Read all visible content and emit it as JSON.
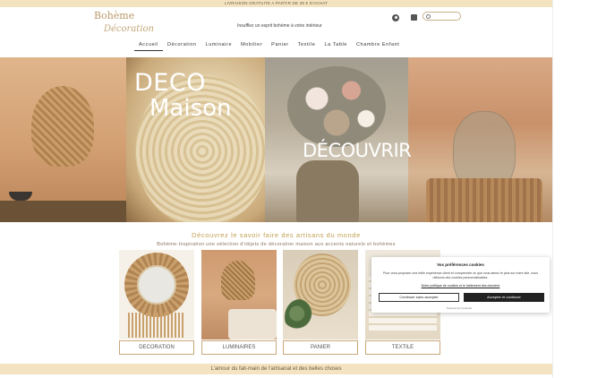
{
  "topbar": {
    "text": "LIVRAISON GRATUITE A PARTIR DE 39 € D'ACHAT"
  },
  "header": {
    "logo_line1": "Bohème",
    "logo_line2": "Décoration",
    "tagline": "Insufflez un esprit bohème à votre intérieur"
  },
  "nav": {
    "items": [
      "Accueil",
      "Décoration",
      "Luminaire",
      "Mobilier",
      "Panier",
      "Textile",
      "La Table",
      "Chambre Enfant"
    ],
    "active": "Accueil"
  },
  "hero": {
    "title_line1": "DECO",
    "title_line2": "Maison",
    "cta": "DÉCOUVRIR"
  },
  "section": {
    "title": "Découvrez le savoir faire des artisans du monde",
    "subtitle": "Bohème-Inspiration une sélection d'objets de décoration maison aux accents naturels et bohèmes"
  },
  "categories": [
    {
      "label": "DECORATION"
    },
    {
      "label": "LUMINAIRES"
    },
    {
      "label": "PANIER"
    },
    {
      "label": "TEXTILE"
    }
  ],
  "footer": {
    "text": "L'amour du fait-main de l'artisanat et des belles choses"
  },
  "cookie": {
    "title": "Vos préférences cookies",
    "text": "Pour vous proposer une belle expérience client et comprendre ce que vous aimez le plus sur notre site, nous utilisons des cookies personnalisables.",
    "policy_link": "Notre politique de cookies et le traitement des données",
    "decline_label": "Continuer sans accepter",
    "accept_label": "Accepter et continuer",
    "powered": "Powered by Consentik"
  },
  "colors": {
    "accent_gold": "#c2a052",
    "band_beige": "#f3e3c0",
    "logo": "#b99a6b"
  },
  "icons": [
    "user-icon",
    "bag-icon",
    "search-icon"
  ]
}
